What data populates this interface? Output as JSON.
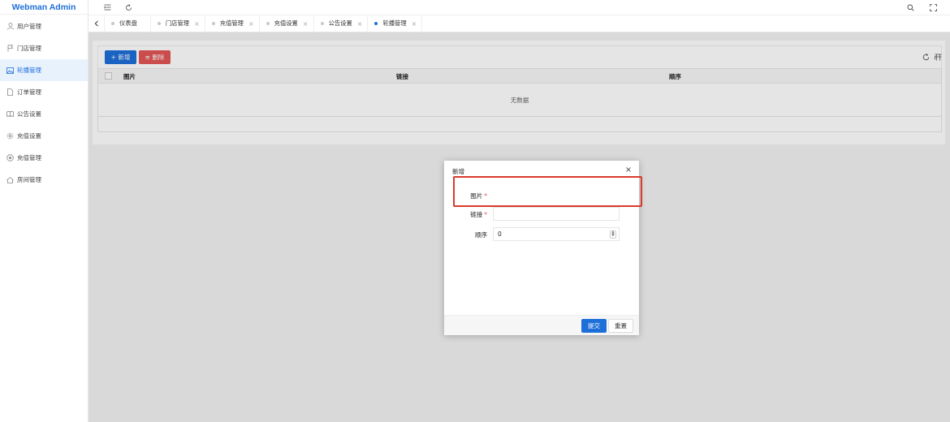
{
  "app": {
    "title": "Webman Admin"
  },
  "sidebar": {
    "items": [
      {
        "label": "用户管理",
        "icon": "user-icon"
      },
      {
        "label": "门店管理",
        "icon": "flag-icon"
      },
      {
        "label": "轮播管理",
        "icon": "image-icon",
        "active": true
      },
      {
        "label": "订单管理",
        "icon": "document-icon"
      },
      {
        "label": "公告设置",
        "icon": "book-icon"
      },
      {
        "label": "充值设置",
        "icon": "gear-icon"
      },
      {
        "label": "充值管理",
        "icon": "target-icon"
      },
      {
        "label": "房间管理",
        "icon": "home-icon"
      }
    ]
  },
  "topbar": {
    "icons": [
      "menu-toggle-icon",
      "refresh-icon",
      "search-icon",
      "fullscreen-icon"
    ]
  },
  "tabs": [
    {
      "label": "仪表盘",
      "closable": false,
      "active": false
    },
    {
      "label": "门店管理",
      "closable": true,
      "active": false
    },
    {
      "label": "充值管理",
      "closable": true,
      "active": false
    },
    {
      "label": "充值设置",
      "closable": true,
      "active": false
    },
    {
      "label": "公告设置",
      "closable": true,
      "active": false
    },
    {
      "label": "轮播管理",
      "closable": true,
      "active": true
    }
  ],
  "toolbar": {
    "add_label": "+ 新增",
    "delete_label": "≡ 删除"
  },
  "table": {
    "columns": [
      "图片",
      "链接",
      "顺序"
    ],
    "empty_text": "无数据"
  },
  "modal": {
    "title": "新增",
    "fields": [
      {
        "label": "图片",
        "required": true,
        "value": ""
      },
      {
        "label": "链接",
        "required": true,
        "value": ""
      },
      {
        "label": "顺序",
        "required": false,
        "value": "0"
      }
    ],
    "required_mark": "*",
    "submit_label": "提交",
    "reset_label": "重置"
  },
  "colors": {
    "primary": "#1e6fd9",
    "danger": "#e25555",
    "highlight": "#d93a2b"
  }
}
